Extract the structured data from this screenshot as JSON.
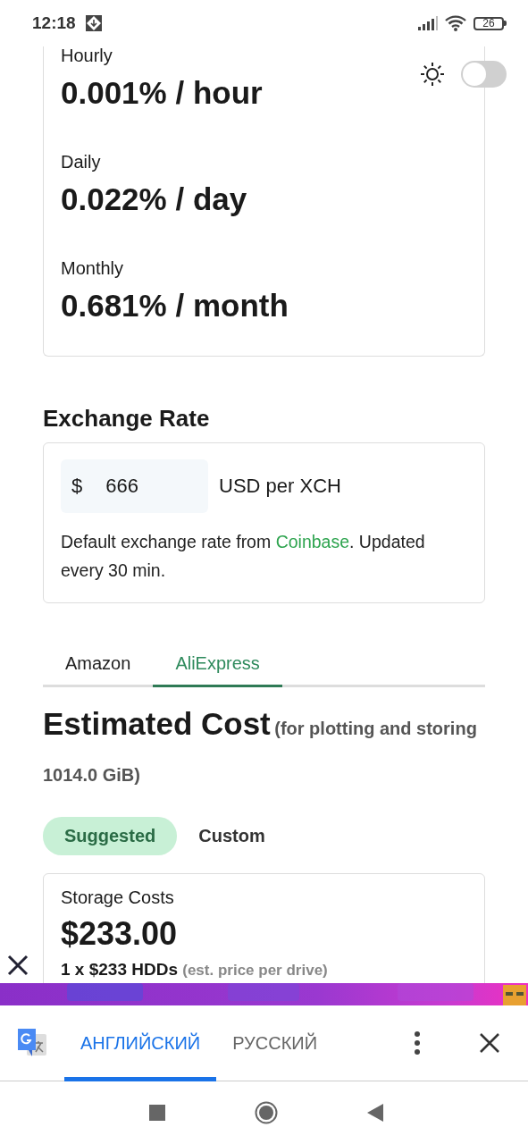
{
  "status_bar": {
    "time": "12:18",
    "battery": "26"
  },
  "theme_toggle": {
    "on": false
  },
  "yield_rates": [
    {
      "label": "Hourly",
      "value": "0.001% / hour"
    },
    {
      "label": "Daily",
      "value": "0.022% / day"
    },
    {
      "label": "Monthly",
      "value": "0.681% / month"
    }
  ],
  "exchange_rate": {
    "title": "Exchange Rate",
    "currency_symbol": "$",
    "value": "666",
    "unit": "USD per XCH",
    "note_before": "Default exchange rate from ",
    "note_link": "Coinbase",
    "note_after": ". Updated every 30 min."
  },
  "store_tabs": [
    {
      "label": "Amazon",
      "selected": false
    },
    {
      "label": "AliExpress",
      "selected": true
    }
  ],
  "estimated_cost": {
    "title": "Estimated Cost",
    "subtitle": "(for plotting and storing 1014.0 GiB)"
  },
  "mode_options": [
    {
      "label": "Suggested",
      "selected": true
    },
    {
      "label": "Custom",
      "selected": false
    }
  ],
  "storage_costs": {
    "label": "Storage Costs",
    "value": "$233.00",
    "detail": "1 x $233 HDDs",
    "detail_note": "(est. price per drive)"
  },
  "translate_bar": {
    "languages": [
      {
        "label": "АНГЛИЙСКИЙ",
        "selected": true
      },
      {
        "label": "РУССКИЙ",
        "selected": false
      }
    ]
  }
}
